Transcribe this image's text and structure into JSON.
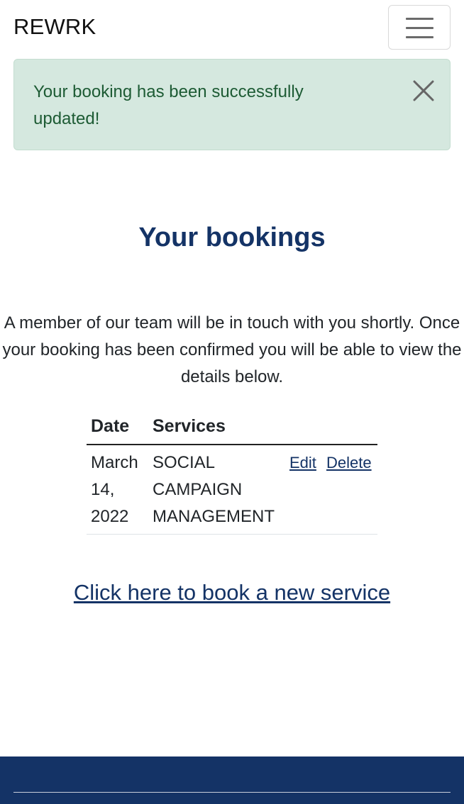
{
  "navbar": {
    "brand": "REWRK",
    "menu_icon": "hamburger-menu-icon"
  },
  "alert": {
    "message": "Your booking has been successfully updated!",
    "close_icon": "close-icon",
    "background_color": "#d5e8df",
    "text_color": "#1d5b34"
  },
  "main": {
    "title": "Your bookings",
    "intro": "A member of our team will be in touch with you shortly. Once your booking has been confirmed you will be able to view the details below.",
    "table": {
      "headers": [
        "Date",
        "Services",
        ""
      ],
      "rows": [
        {
          "date": "March 14, 2022",
          "service": "SOCIAL CAMPAIGN MANAGEMENT",
          "edit_label": "Edit",
          "delete_label": "Delete"
        }
      ]
    },
    "book_link": "Click here to book a new service"
  },
  "colors": {
    "brand_navy": "#143366"
  }
}
